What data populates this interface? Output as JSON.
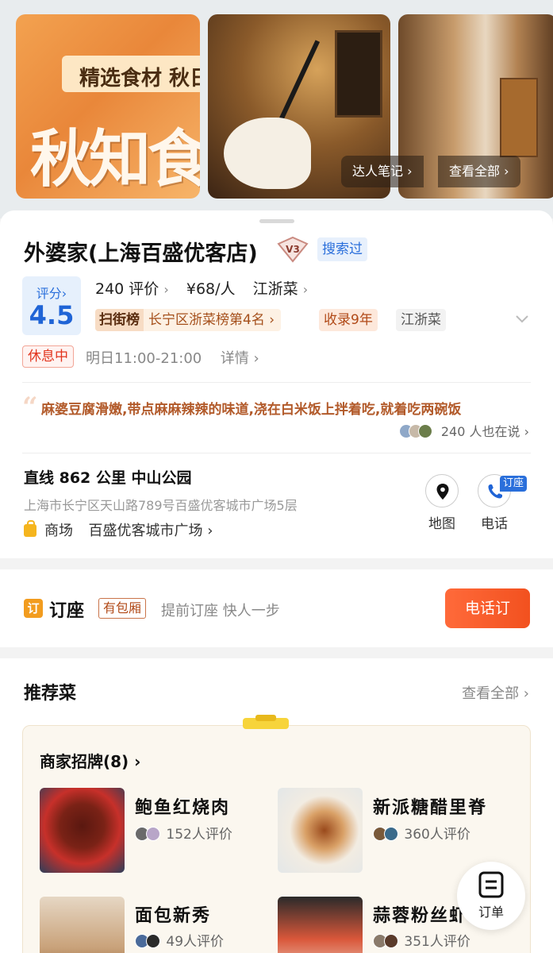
{
  "gallery": {
    "photo1_band_text": "精选食材 秋日",
    "photo1_big_text": "秋知食",
    "notes_btn": "达人笔记 ›",
    "view_all_btn": "查看全部 ›"
  },
  "shop": {
    "name": "外婆家(上海百盛优客店)",
    "level_badge": "V3",
    "searched_tag": "搜索过",
    "score_label": "评分›",
    "score_value": "4.5",
    "reviews": "240 评价",
    "price": "¥68/人",
    "cuisine": "江浙菜",
    "rank_logo": "扫街榜",
    "rank_text": "长宁区浙菜榜第4名 ›",
    "year_tag": "收录9年",
    "cuisine_tag": "江浙菜",
    "status": "休息中",
    "hours": "明日11:00-21:00",
    "hours_detail": "详情 ›"
  },
  "review": {
    "text": "麻婆豆腐滑嫩,带点麻麻辣辣的味道,浇在白米饭上拌着吃,就着吃两碗饭",
    "count": "240 人也在说 ›"
  },
  "location": {
    "distance": "直线 862 公里 中山公园",
    "address": "上海市长宁区天山路789号百盛优客城市广场5层",
    "mall_label": "商场",
    "mall_name": "百盛优客城市广场 ›",
    "map_label": "地图",
    "phone_label": "电话",
    "book_badge": "订座"
  },
  "booking": {
    "icon": "订",
    "title": "订座",
    "private_room": "有包厢",
    "subtitle": "提前订座 快人一步",
    "call_button": "电话订"
  },
  "recommend": {
    "title": "推荐菜",
    "view_all": "查看全部 ›",
    "menu_head": "商家招牌(8) ›",
    "dishes": [
      {
        "name": "鲍鱼红烧肉",
        "reviews": "152人评价"
      },
      {
        "name": "新派糖醋里脊",
        "reviews": "360人评价"
      },
      {
        "name": "面包新秀",
        "reviews": "49人评价"
      },
      {
        "name": "蒜蓉粉丝虾",
        "reviews": "351人评价"
      }
    ]
  },
  "floating": {
    "order_label": "订单"
  },
  "colors": {
    "accent_blue": "#2a6fdb",
    "accent_orange": "#f2511f",
    "status_red": "#e2341d"
  }
}
